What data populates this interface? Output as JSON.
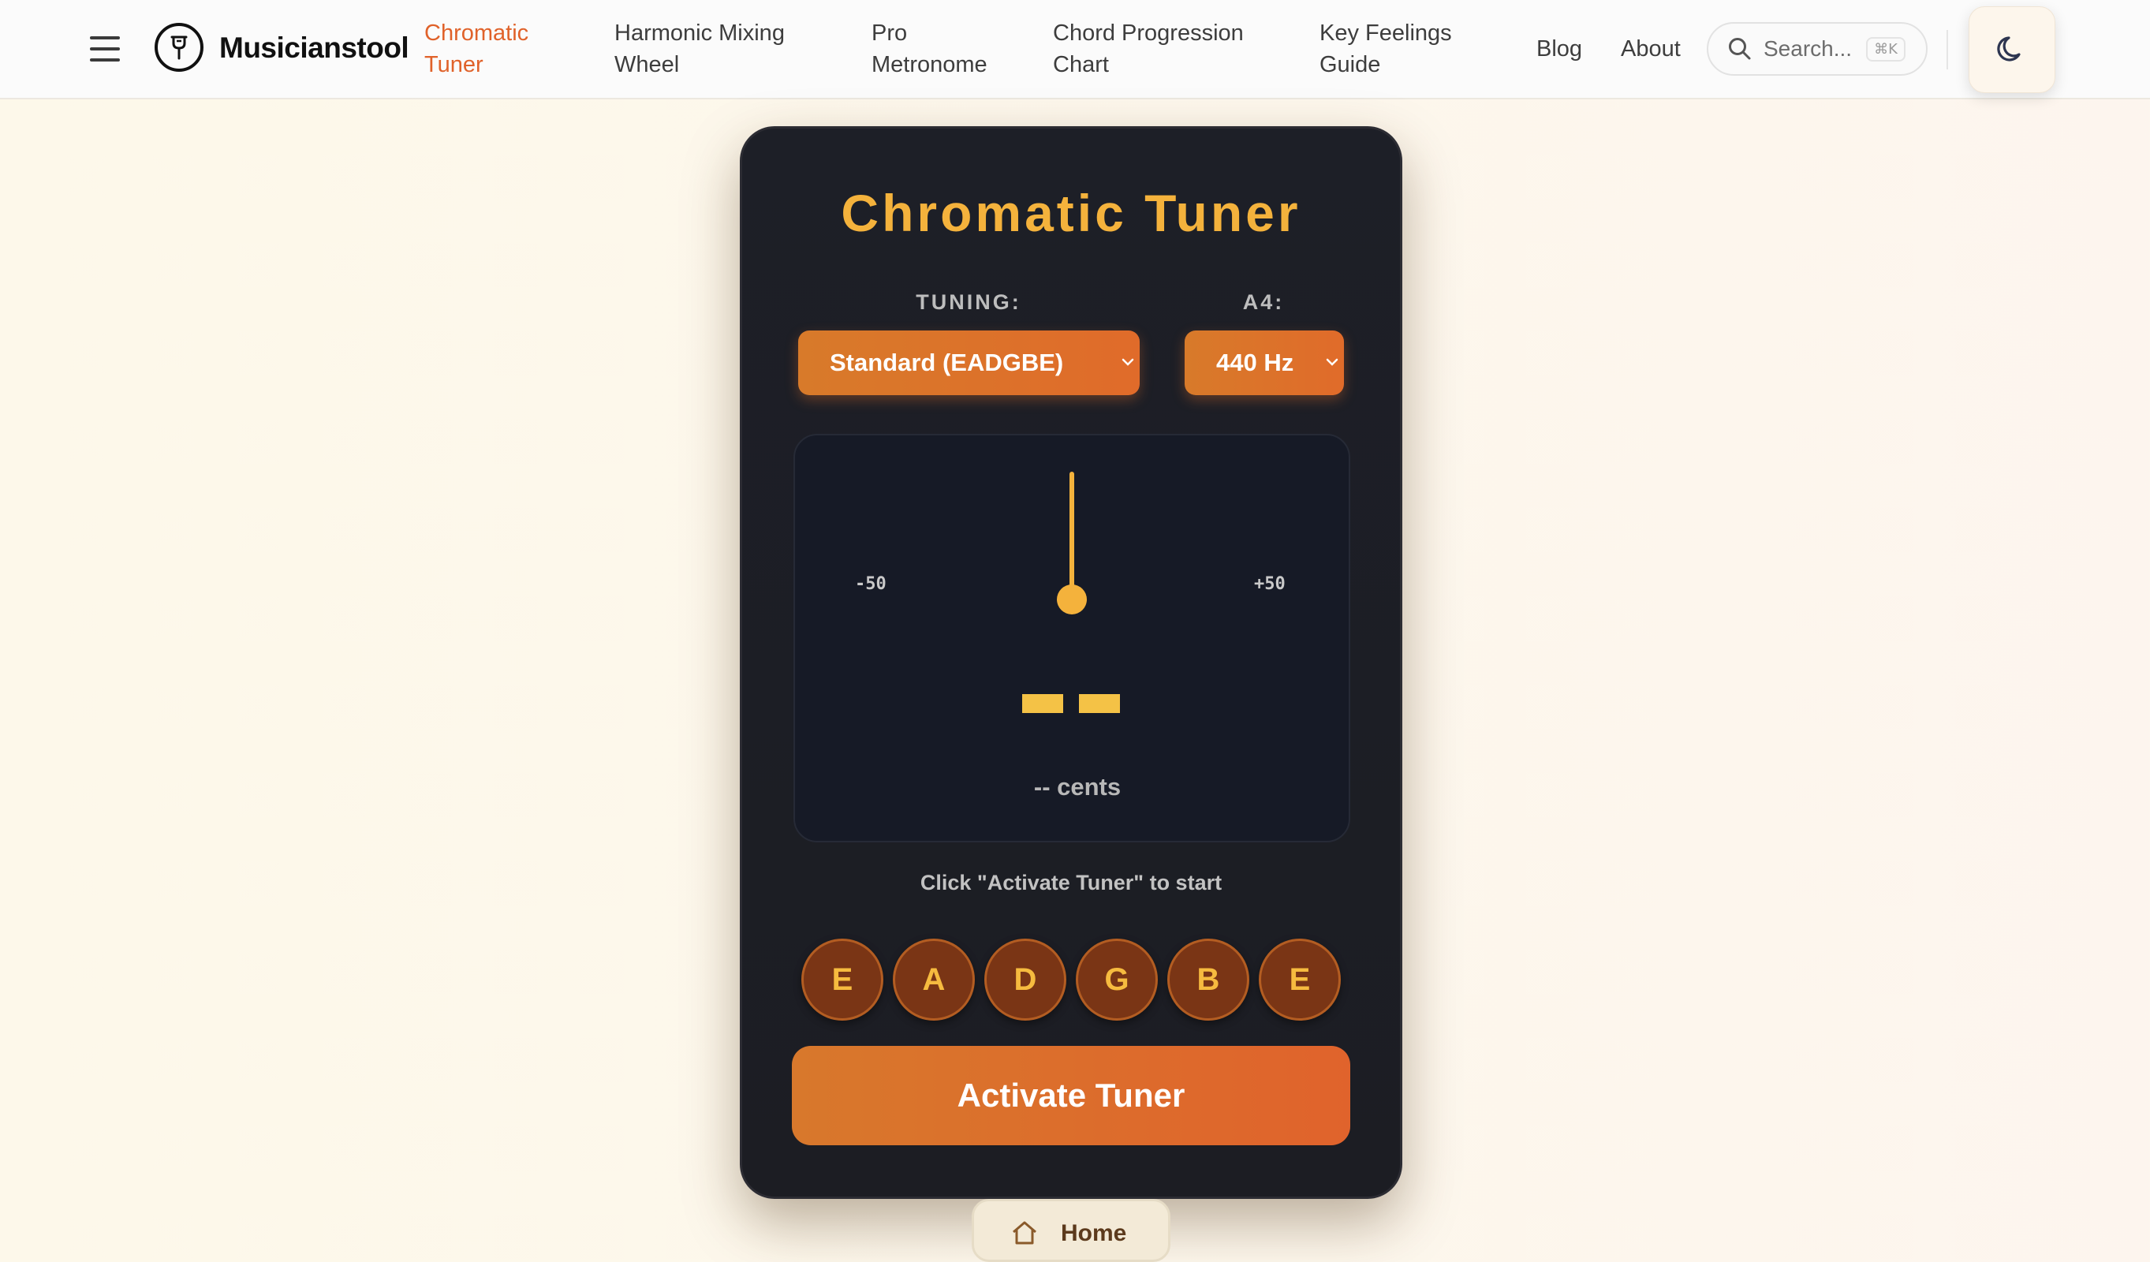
{
  "nav": {
    "brand": "Musicianstool",
    "links": [
      {
        "line1": "Chromatic",
        "line2": "Tuner",
        "active": true
      },
      {
        "line1": "Harmonic Mixing",
        "line2": "Wheel"
      },
      {
        "line1": "Pro",
        "line2": "Metronome"
      },
      {
        "line1": "Chord Progression",
        "line2": "Chart"
      },
      {
        "line1": "Key Feelings",
        "line2": "Guide"
      },
      {
        "line1": "Blog"
      },
      {
        "line1": "About"
      }
    ],
    "search": {
      "placeholder": "Search...",
      "shortcut": "⌘K"
    },
    "icons": {
      "menu": "hamburger-icon",
      "logo": "tuning-fork-icon",
      "search": "search-icon",
      "theme": "moon-icon"
    }
  },
  "tuner": {
    "title": "Chromatic Tuner",
    "tuning_label": "TUNING:",
    "tuning_value": "Standard (EADGBE)",
    "a4_label": "A4:",
    "a4_value": "440 Hz",
    "scale_min": "-50",
    "scale_max": "+50",
    "note_display": "--",
    "cents_text": "-- cents",
    "status": "Click \"Activate Tuner\" to start",
    "strings": [
      "E",
      "A",
      "D",
      "G",
      "B",
      "E"
    ],
    "activate_label": "Activate Tuner"
  },
  "footer": {
    "home_label": "Home",
    "home_icon": "home-icon"
  },
  "colors": {
    "accent": "#e0622a",
    "gold": "#f4b23c",
    "card_bg": "#1d1f27",
    "page_bg": "#fdf8ea"
  }
}
